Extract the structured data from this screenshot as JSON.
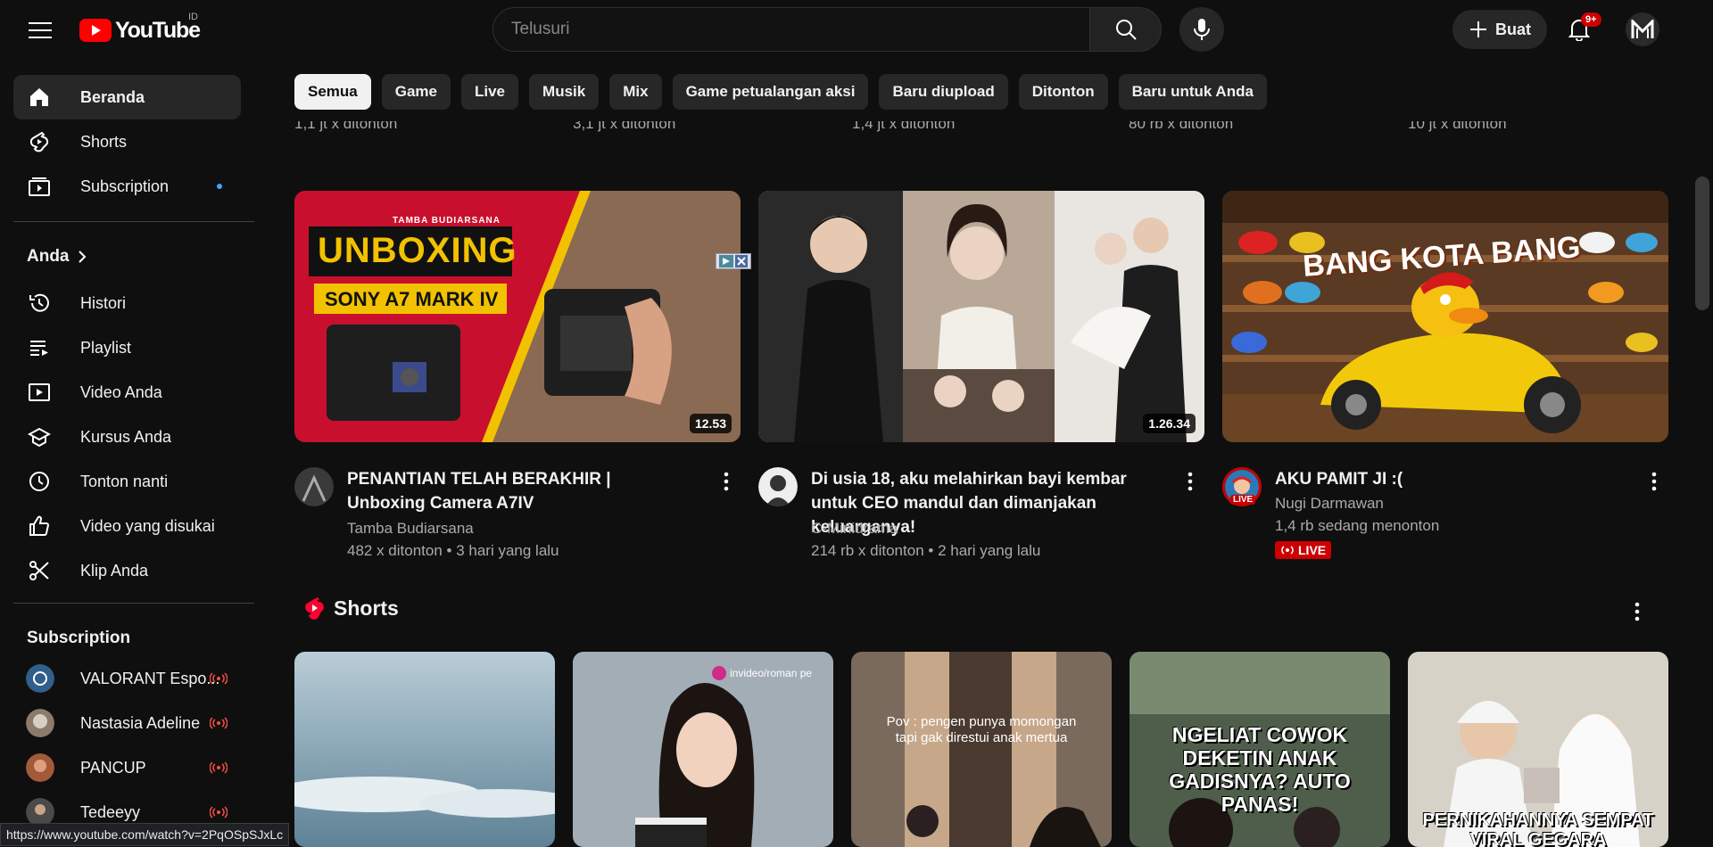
{
  "header": {
    "logo_text": "YouTube",
    "country_code": "ID",
    "search_placeholder": "Telusuri",
    "create_label": "Buat",
    "notification_count": "9+"
  },
  "sidebar": {
    "main": [
      {
        "label": "Beranda",
        "icon": "home-icon",
        "active": true
      },
      {
        "label": "Shorts",
        "icon": "shorts-icon"
      },
      {
        "label": "Subscription",
        "icon": "subscriptions-icon",
        "dot": true
      }
    ],
    "you_title": "Anda",
    "you": [
      {
        "label": "Histori",
        "icon": "history-icon"
      },
      {
        "label": "Playlist",
        "icon": "playlist-icon"
      },
      {
        "label": "Video Anda",
        "icon": "your-videos-icon"
      },
      {
        "label": "Kursus Anda",
        "icon": "courses-icon"
      },
      {
        "label": "Tonton nanti",
        "icon": "watch-later-icon"
      },
      {
        "label": "Video yang disukai",
        "icon": "liked-videos-icon"
      },
      {
        "label": "Klip Anda",
        "icon": "clips-icon"
      }
    ],
    "subs_title": "Subscription",
    "subs": [
      {
        "label": "VALORANT Espo...",
        "color": "#2f5f8a"
      },
      {
        "label": "Nastasia Adeline",
        "color": "#8b7b6a"
      },
      {
        "label": "PANCUP",
        "color": "#a35a3a"
      },
      {
        "label": "Tedeeyy",
        "color": "#4a4a4a"
      }
    ]
  },
  "chips": [
    "Semua",
    "Game",
    "Live",
    "Musik",
    "Mix",
    "Game petualangan aksi",
    "Baru diupload",
    "Ditonton",
    "Baru untuk Anda"
  ],
  "residual_views": [
    "1,1 jt x ditonton",
    "3,1 jt x ditonton",
    "1,4 jt x ditonton",
    "80 rb x ditonton",
    "10 jt x ditonton"
  ],
  "videos": [
    {
      "title": "PENANTIAN TELAH BERAKHIR | Unboxing Camera A7IV",
      "channel": "Tamba Budiarsana",
      "views": "482 x ditonton",
      "age": "3 hari yang lalu",
      "duration": "12.53",
      "thumb_brand": "TAMBA BUDIARSANA",
      "thumb_big": "UNBOXING",
      "thumb_sub": "SONY A7 MARK IV"
    },
    {
      "title": "Di usia 18, aku melahirkan bayi kembar untuk CEO mandul dan dimanjakan keluarganya!",
      "channel": "C-Minidrama",
      "views": "214 rb x ditonton",
      "age": "2 hari yang lalu",
      "duration": "1.26.34"
    },
    {
      "title": "AKU PAMIT JI :(",
      "channel": "Nugi Darmawan",
      "watching": "1,4 rb sedang menonton",
      "live_label": "LIVE",
      "avatar_live": "LIVE",
      "thumb_text": "BANG KOTA BANG"
    }
  ],
  "shorts": {
    "title": "Shorts",
    "items": [
      {
        "caption": "",
        "bg": "#8fa9b6"
      },
      {
        "caption": "invideo/roman pe",
        "bg": "#9aa4ad"
      },
      {
        "caption": "Pov : pengen punya momongan tapi gak direstui anak mertua",
        "bg": "#7a6a5c"
      },
      {
        "caption": "NGELIAT COWOK DEKETIN ANAK GADISNYA? AUTO PANAS!",
        "bg": "#4a5a48"
      },
      {
        "caption": "PERNIKAHANNYA SEMPAT VIRAL GEGARA",
        "bg": "#c9c3b6"
      }
    ]
  },
  "status_url": "https://www.youtube.com/watch?v=2PqOSpSJxLc"
}
